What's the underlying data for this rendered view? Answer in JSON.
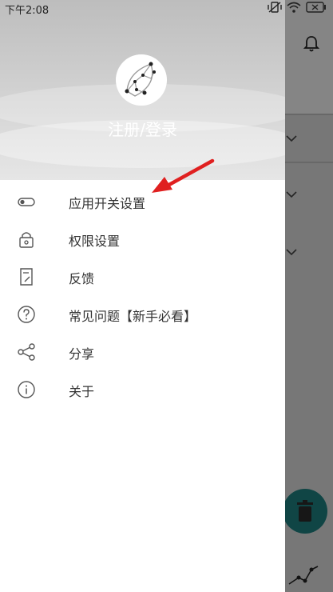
{
  "status_bar": {
    "time": "下午2:08"
  },
  "drawer": {
    "login_label": "注册/登录",
    "items": [
      {
        "label": "应用开关设置",
        "icon": "toggle-icon"
      },
      {
        "label": "权限设置",
        "icon": "lock-icon"
      },
      {
        "label": "反馈",
        "icon": "edit-note-icon"
      },
      {
        "label": "常见问题【新手必看】",
        "icon": "question-circle-icon"
      },
      {
        "label": "分享",
        "icon": "share-icon"
      },
      {
        "label": "关于",
        "icon": "info-circle-icon"
      }
    ]
  },
  "colors": {
    "accent_fab": "#1e7f7f",
    "arrow": "#e02020",
    "label": "#333333"
  }
}
